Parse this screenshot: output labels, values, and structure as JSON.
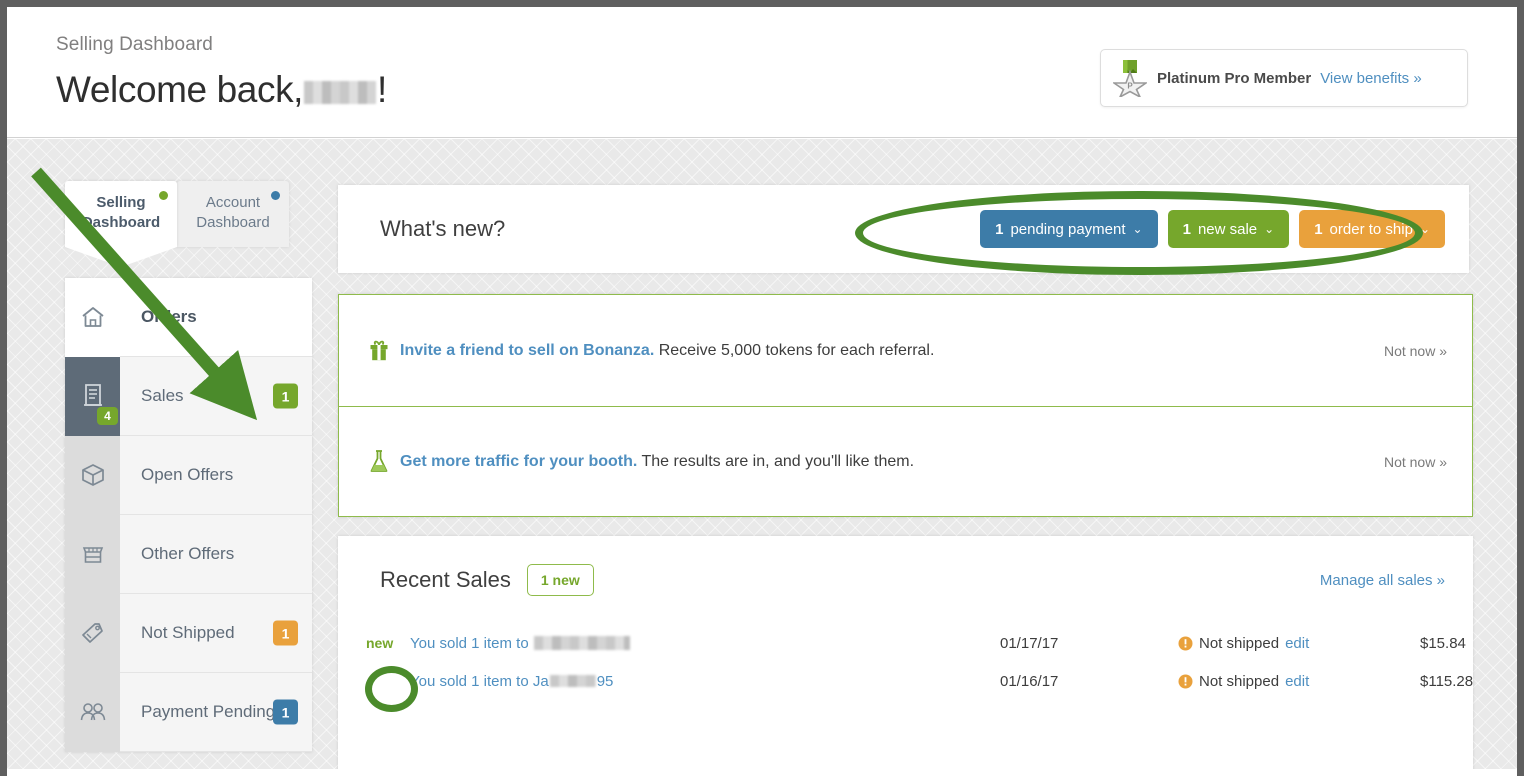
{
  "header": {
    "breadcrumb": "Selling Dashboard",
    "welcome_prefix": "Welcome back,",
    "welcome_suffix": "!",
    "member_badge": {
      "icon": "medal-star-icon",
      "label": "Platinum Pro Member",
      "link": "View benefits »"
    }
  },
  "tabs": [
    {
      "label_line1": "Selling",
      "label_line2": "Dashboard",
      "active": true,
      "dot_color": "#76a72c"
    },
    {
      "label_line1": "Account",
      "label_line2": "Dashboard",
      "active": false,
      "dot_color": "#3d7ca8"
    }
  ],
  "sidebar": {
    "items": [
      {
        "label": "Orders",
        "icon": "home-icon",
        "badge": "",
        "badge_color": "",
        "active": false,
        "header": true,
        "icon_badge": ""
      },
      {
        "label": "Sales",
        "icon": "receipt-icon",
        "badge": "1",
        "badge_color": "#76a72c",
        "active": true,
        "header": false,
        "icon_badge": "4"
      },
      {
        "label": "Open Offers",
        "icon": "box-icon",
        "badge": "",
        "badge_color": "",
        "active": false,
        "header": false,
        "icon_badge": ""
      },
      {
        "label": "Other Offers",
        "icon": "storefront-icon",
        "badge": "",
        "badge_color": "",
        "active": false,
        "header": false,
        "icon_badge": ""
      },
      {
        "label": "Not Shipped",
        "icon": "tag-icon",
        "badge": "1",
        "badge_color": "#e9a13c",
        "active": false,
        "header": false,
        "icon_badge": ""
      },
      {
        "label": "Payment Pending",
        "icon": "people-icon",
        "badge": "1",
        "badge_color": "#3d7ca8",
        "active": false,
        "header": false,
        "icon_badge": ""
      }
    ]
  },
  "whats_new": {
    "title": "What's new?",
    "buttons": [
      {
        "count": "1",
        "text": "pending payment",
        "color": "#3d7ca8",
        "chevron": "⌄"
      },
      {
        "count": "1",
        "text": "new sale",
        "color": "#76a72c",
        "chevron": "⌄"
      },
      {
        "count": "1",
        "text": "order to ship",
        "color": "#e9a13c",
        "chevron": "⌄"
      }
    ]
  },
  "notices": [
    {
      "icon": "gift-icon",
      "link_text": "Invite a friend to sell on Bonanza.",
      "body_text": " Receive 5,000 tokens for each referral.",
      "dismiss": "Not now »"
    },
    {
      "icon": "flask-icon",
      "link_text": "Get more traffic for your booth.",
      "body_text": " The results are in, and you'll like them.",
      "dismiss": "Not now »"
    }
  ],
  "recent_sales": {
    "title": "Recent Sales",
    "new_badge": "1 new",
    "manage_link": "Manage all sales »",
    "rows": [
      {
        "new_flag": "new",
        "description_prefix": "You sold 1 item to",
        "buyer_redacted": true,
        "buyer_visible": "",
        "date": "01/17/17",
        "status_icon": "warning-icon",
        "status": "Not shipped",
        "edit": "edit",
        "amount": "$15.84"
      },
      {
        "new_flag": "",
        "description_prefix": "You sold 1 item to",
        "buyer_redacted": true,
        "buyer_visible": "Ja",
        "buyer_suffix": "95",
        "date": "01/16/17",
        "status_icon": "warning-icon",
        "status": "Not shipped",
        "edit": "edit",
        "amount": "$115.28"
      }
    ]
  },
  "annotations": {
    "arrow_color": "#4b8b2b",
    "ellipse_color": "#4b8b2b"
  }
}
